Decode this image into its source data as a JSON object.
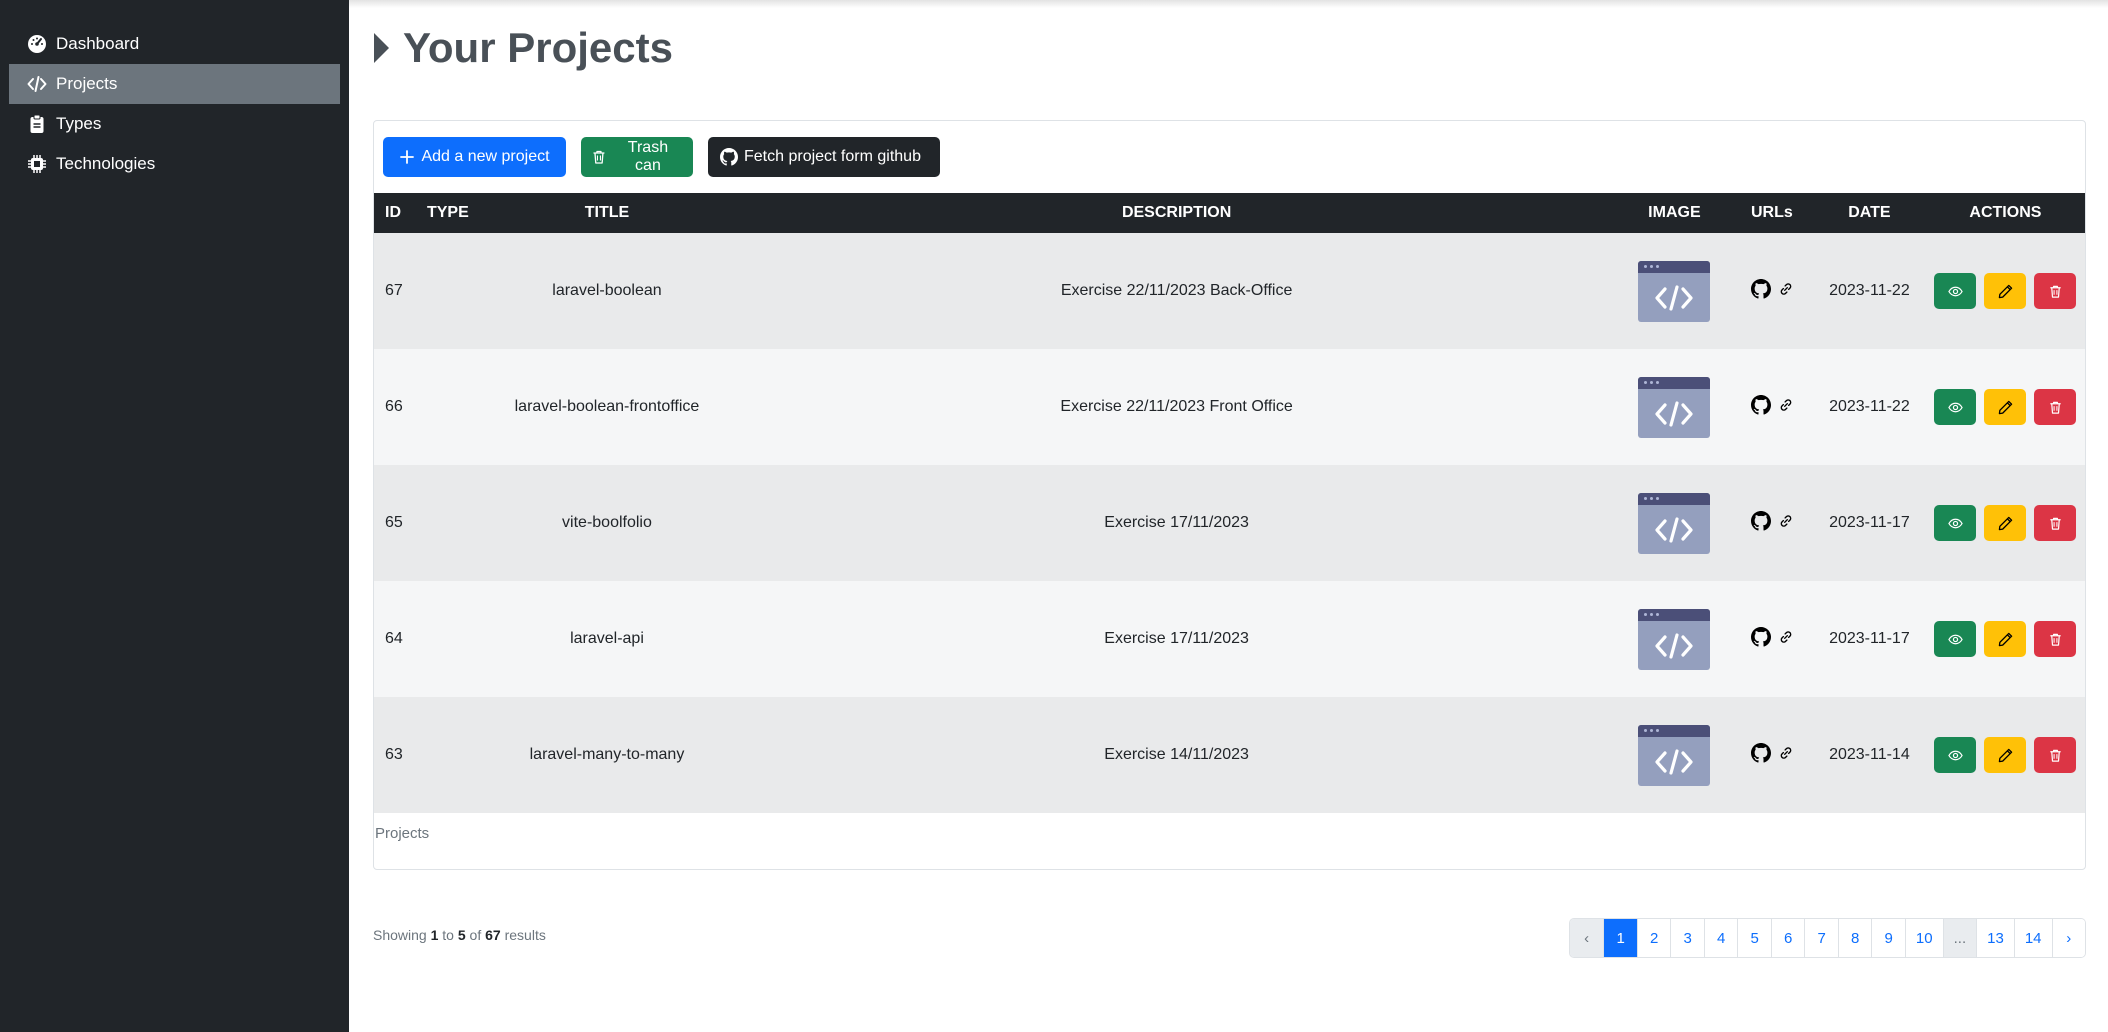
{
  "sidebar": {
    "items": [
      {
        "label": "Dashboard",
        "icon": "dashboard-icon",
        "active": false
      },
      {
        "label": "Projects",
        "icon": "code-icon",
        "active": true
      },
      {
        "label": "Types",
        "icon": "clipboard-icon",
        "active": false
      },
      {
        "label": "Technologies",
        "icon": "chip-icon",
        "active": false
      }
    ]
  },
  "header": {
    "title": "Your Projects"
  },
  "toolbar": {
    "add_label": "Add a new project",
    "trash_label": "Trash can",
    "fetch_label": "Fetch project form github"
  },
  "table": {
    "headers": [
      "ID",
      "TYPE",
      "TITLE",
      "DESCRIPTION",
      "IMAGE",
      "URLs",
      "DATE",
      "ACTIONS"
    ],
    "rows": [
      {
        "id": "67",
        "type": "",
        "title": "laravel-boolean",
        "description": "Exercise 22/11/2023 Back-Office",
        "date": "2023-11-22"
      },
      {
        "id": "66",
        "type": "",
        "title": "laravel-boolean-frontoffice",
        "description": "Exercise 22/11/2023 Front Office",
        "date": "2023-11-22"
      },
      {
        "id": "65",
        "type": "",
        "title": "vite-boolfolio",
        "description": "Exercise 17/11/2023",
        "date": "2023-11-17"
      },
      {
        "id": "64",
        "type": "",
        "title": "laravel-api",
        "description": "Exercise 17/11/2023",
        "date": "2023-11-17"
      },
      {
        "id": "63",
        "type": "",
        "title": "laravel-many-to-many",
        "description": "Exercise 14/11/2023",
        "date": "2023-11-14"
      }
    ],
    "caption": "Projects"
  },
  "footer": {
    "showing_prefix": "Showing",
    "from": "1",
    "to_word": "to",
    "to": "5",
    "of_word": "of",
    "total": "67",
    "suffix": "results"
  },
  "pagination": {
    "prev": "‹",
    "pages": [
      "1",
      "2",
      "3",
      "4",
      "5",
      "6",
      "7",
      "8",
      "9",
      "10",
      "...",
      "13",
      "14"
    ],
    "active": "1",
    "next": "›"
  },
  "colors": {
    "sidebar_bg": "#212529",
    "primary": "#0d6efd",
    "success": "#198754",
    "warning": "#ffc107",
    "danger": "#dc3545"
  }
}
